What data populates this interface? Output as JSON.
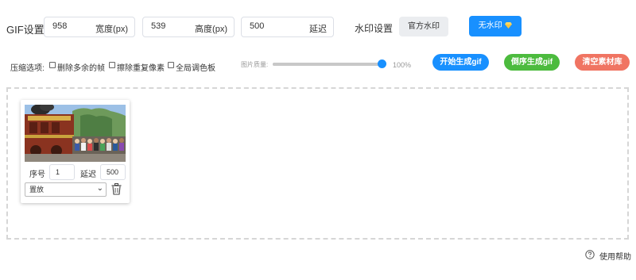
{
  "gif_settings": {
    "label": "GIF设置:",
    "width": {
      "value": "958",
      "suffix": "宽度(px)"
    },
    "height": {
      "value": "539",
      "suffix": "高度(px)"
    },
    "delay": {
      "value": "500",
      "suffix": "延迟"
    }
  },
  "watermark": {
    "label": "水印设置",
    "official_label": "官方水印",
    "none_label": "无水印",
    "none_icon": "gem-icon"
  },
  "compression": {
    "label": "压缩选项:",
    "options": [
      {
        "label": "删除多余的帧",
        "checked": false
      },
      {
        "label": "擦除重复像素",
        "checked": false
      },
      {
        "label": "全局调色板",
        "checked": false
      }
    ]
  },
  "quality": {
    "label": "图片质量:",
    "value": 100,
    "display": "100%"
  },
  "actions": {
    "start_label": "开始生成gif",
    "reverse_label": "倒序生成gif",
    "clear_label": "清空素材库"
  },
  "frames": [
    {
      "index_label": "序号",
      "index_value": "1",
      "delay_label": "延迟",
      "delay_value": "500",
      "mode_value": "置放",
      "photo_icon": "parade-photo"
    }
  ],
  "help": {
    "label": "使用帮助",
    "icon": "question-circle-icon"
  },
  "colors": {
    "primary": "#1890ff",
    "green": "#4cbb3e",
    "red": "#f07462",
    "gray_button": "#ebedf0"
  }
}
